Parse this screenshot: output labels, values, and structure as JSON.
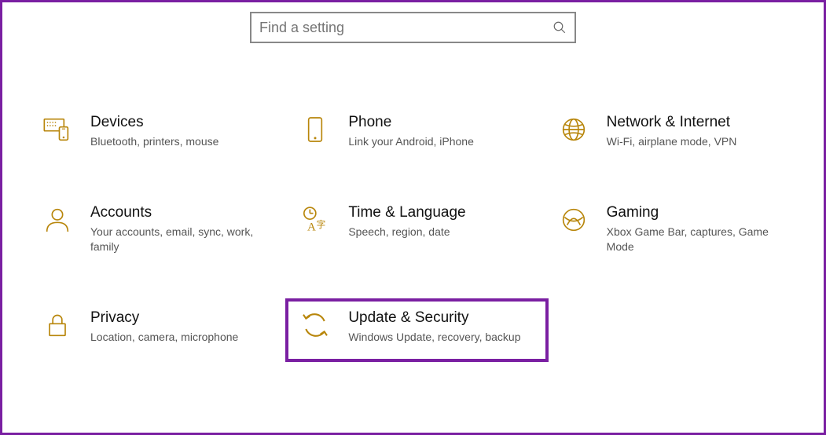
{
  "colors": {
    "accent": "#b8860b",
    "highlight": "#7a1fa2",
    "border": "#888",
    "text": "#111",
    "subtext": "#555"
  },
  "search": {
    "placeholder": "Find a setting"
  },
  "tiles": {
    "devices": {
      "title": "Devices",
      "desc": "Bluetooth, printers, mouse"
    },
    "phone": {
      "title": "Phone",
      "desc": "Link your Android, iPhone"
    },
    "network": {
      "title": "Network & Internet",
      "desc": "Wi-Fi, airplane mode, VPN"
    },
    "accounts": {
      "title": "Accounts",
      "desc": "Your accounts, email, sync, work, family"
    },
    "timelang": {
      "title": "Time & Language",
      "desc": "Speech, region, date"
    },
    "gaming": {
      "title": "Gaming",
      "desc": "Xbox Game Bar, captures, Game Mode"
    },
    "privacy": {
      "title": "Privacy",
      "desc": "Location, camera, microphone"
    },
    "update": {
      "title": "Update & Security",
      "desc": "Windows Update, recovery, backup"
    }
  }
}
